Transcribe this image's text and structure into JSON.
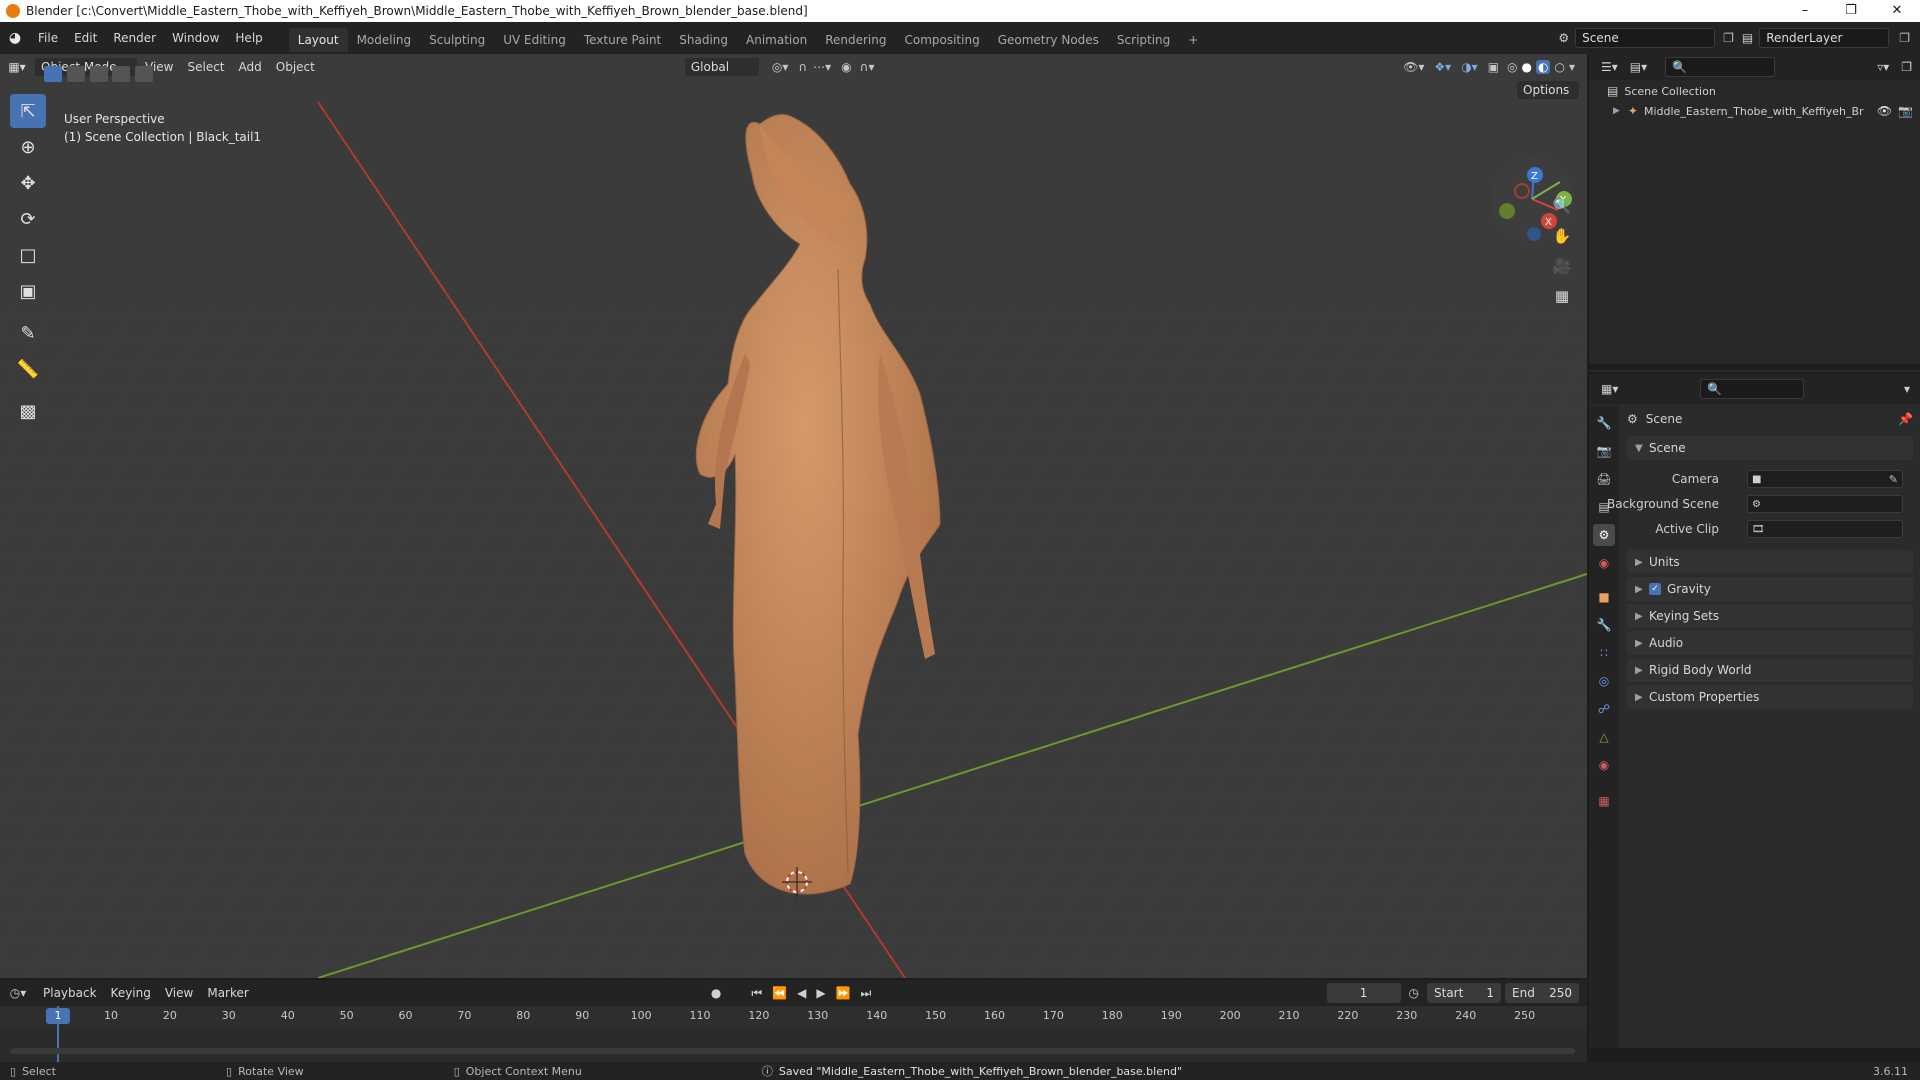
{
  "window": {
    "title": "Blender [c:\\Convert\\Middle_Eastern_Thobe_with_Keffiyeh_Brown\\Middle_Eastern_Thobe_with_Keffiyeh_Brown_blender_base.blend]",
    "minimize": "–",
    "maximize": "❐",
    "close": "✕"
  },
  "menu": [
    "File",
    "Edit",
    "Render",
    "Window",
    "Help"
  ],
  "workspaces": [
    {
      "label": "Layout",
      "active": true
    },
    {
      "label": "Modeling"
    },
    {
      "label": "Sculpting"
    },
    {
      "label": "UV Editing"
    },
    {
      "label": "Texture Paint"
    },
    {
      "label": "Shading"
    },
    {
      "label": "Animation"
    },
    {
      "label": "Rendering"
    },
    {
      "label": "Compositing"
    },
    {
      "label": "Geometry Nodes"
    },
    {
      "label": "Scripting"
    }
  ],
  "add_workspace": "+",
  "scene_field": "Scene",
  "renderlayer_field": "RenderLayer",
  "viewport": {
    "mode": "Object Mode",
    "menus": [
      "View",
      "Select",
      "Add",
      "Object"
    ],
    "transform_orientation": "Global",
    "options": "Options",
    "overlay_line1": "User Perspective",
    "overlay_line2": "(1) Scene Collection | Black_tail1",
    "gizmo_axes": {
      "x": "X",
      "y": "Y",
      "z": "Z"
    },
    "colors": {
      "bg": "#3c3c3c",
      "grid": "#444444",
      "x_axis": "#c0392b",
      "y_axis": "#6a9a2a",
      "model": "#c98a5e",
      "accent": "#4772b3"
    }
  },
  "tools": [
    "select-box",
    "cursor",
    "move",
    "rotate",
    "scale",
    "transform",
    "annotate",
    "measure",
    "add-cube"
  ],
  "outliner": {
    "root": "Scene Collection",
    "item": "Middle_Eastern_Thobe_with_Keffiyeh_Br"
  },
  "properties": {
    "context_title": "Scene",
    "section": "Scene",
    "fields": [
      {
        "label": "Camera"
      },
      {
        "label": "Background Scene"
      },
      {
        "label": "Active Clip"
      }
    ],
    "panels": [
      "Units",
      "Gravity",
      "Keying Sets",
      "Audio",
      "Rigid Body World",
      "Custom Properties"
    ],
    "gravity_checked": true
  },
  "timeline": {
    "menus": [
      "Playback",
      "Keying",
      "View",
      "Marker"
    ],
    "current_frame": "1",
    "start_label": "Start",
    "start": "1",
    "end_label": "End",
    "end": "250",
    "ruler": [
      "1",
      "10",
      "20",
      "30",
      "40",
      "50",
      "60",
      "70",
      "80",
      "90",
      "100",
      "110",
      "120",
      "130",
      "140",
      "150",
      "160",
      "170",
      "180",
      "190",
      "200",
      "210",
      "220",
      "230",
      "240",
      "250"
    ]
  },
  "status": {
    "select": "Select",
    "rotate": "Rotate View",
    "context": "Object Context Menu",
    "message": "Saved \"Middle_Eastern_Thobe_with_Keffiyeh_Brown_blender_base.blend\"",
    "version": "3.6.11"
  }
}
